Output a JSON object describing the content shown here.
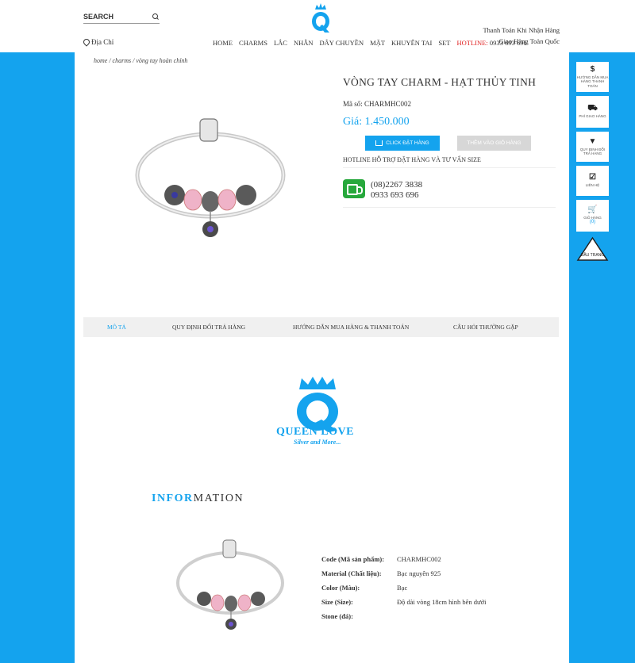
{
  "header": {
    "search_placeholder": "SEARCH",
    "address": "Địa Chỉ",
    "nav": [
      "HOME",
      "CHARMS",
      "LẮC",
      "NHẪN",
      "DÂY CHUYỀN",
      "MẶT",
      "KHUYÊN TAI",
      "SET"
    ],
    "hotline_label": "HOTLINE:",
    "hotline_number": "0933 693 696",
    "top_right_1": "Thanh Toán Khi Nhận Hàng",
    "top_right_2": "Giao Hàng Toàn Quốc"
  },
  "breadcrumb": "home / charms / vòng tay hoàn chỉnh",
  "product": {
    "title": "VÒNG TAY CHARM - HẠT THỦY TINH",
    "sku": "Mã số: CHARMHC002",
    "price": "Giá: 1.450.000",
    "order_button": "CLICK ĐẶT HÀNG",
    "cart_button": "THÊM VÀO GIỎ HÀNG",
    "hotline_title": "HOTLINE HỖ TRỢ ĐẶT HÀNG VÀ TƯ VẤN SIZE",
    "phone1": "(08)2267 3838",
    "phone2": "0933 693 696"
  },
  "floating": [
    {
      "icon": "$",
      "label": "HƯỚNG DẪN MUA HÀNG THANH TOÁN"
    },
    {
      "icon": "⛟",
      "label": "PHÍ GIAO HÀNG"
    },
    {
      "icon": "▼",
      "label": "QUY ĐỊNH ĐỔI TRẢ HÀNG"
    },
    {
      "icon": "☑",
      "label": "LIÊN HỆ"
    },
    {
      "icon": "🛒",
      "label": "GIỎ HÀNG",
      "count": "(0)"
    }
  ],
  "back_to_top": "ĐẦU TRANG",
  "tabs": [
    "MÔ TẢ",
    "QUY ĐỊNH ĐỔI TRẢ HÀNG",
    "HƯỚNG DẪN MUA HÀNG & THANH TOÁN",
    "CÂU HỎI THƯỜNG GẶP"
  ],
  "brand": {
    "name": "QUEEN LOVE",
    "tagline": "Silver and More..."
  },
  "info": {
    "title_bold": "INFOR",
    "title_rest": "MATION"
  },
  "specs": [
    {
      "key": "Code (Mã sản phẩm):",
      "value": "CHARMHC002"
    },
    {
      "key": "Material (Chất liệu):",
      "value": "Bạc nguyên 925"
    },
    {
      "key": "Color (Màu):",
      "value": "Bạc"
    },
    {
      "key": "Size (Size):",
      "value": "Độ dài vòng 18cm hình bên dưới"
    },
    {
      "key": "Stone (đá):",
      "value": ""
    }
  ],
  "colors": {
    "accent": "#14a3ee",
    "hotline": "#e02020",
    "phone_green": "#27a83c"
  }
}
